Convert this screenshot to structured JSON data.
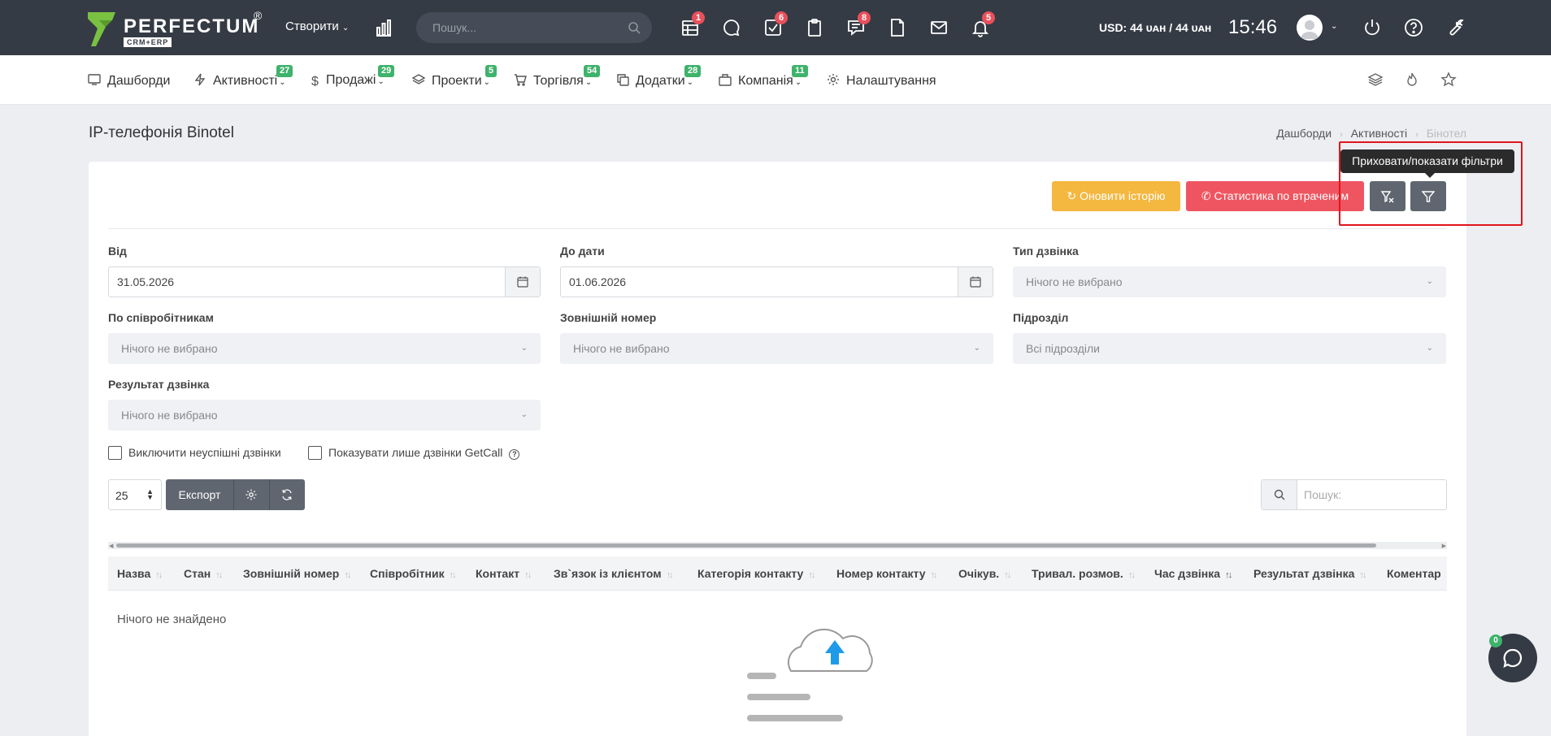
{
  "topbar": {
    "logo_text": "PERFECTUM",
    "logo_reg": "®",
    "logo_sub": "CRM+ERP",
    "create_label": "Створити",
    "search_placeholder": "Пошук...",
    "icons": [
      {
        "name": "calendar-grid-icon",
        "badge": "1"
      },
      {
        "name": "chat-bubble-icon",
        "badge": ""
      },
      {
        "name": "tasks-check-icon",
        "badge": "6"
      },
      {
        "name": "clipboard-icon",
        "badge": ""
      },
      {
        "name": "messages-icon",
        "badge": "8"
      },
      {
        "name": "document-icon",
        "badge": ""
      },
      {
        "name": "mail-icon",
        "badge": ""
      },
      {
        "name": "bell-icon",
        "badge": "5"
      }
    ],
    "currency": "USD: 44 ᴜᴀʜ / 44 ᴜᴀʜ",
    "clock": "15:46"
  },
  "menu": {
    "items": [
      {
        "label": "Дашборди",
        "badge": ""
      },
      {
        "label": "Активності",
        "badge": "27"
      },
      {
        "label": "Продажі",
        "badge": "29"
      },
      {
        "label": "Проекти",
        "badge": "5"
      },
      {
        "label": "Торгівля",
        "badge": "54"
      },
      {
        "label": "Додатки",
        "badge": "28"
      },
      {
        "label": "Компанія",
        "badge": "11"
      },
      {
        "label": "Налаштування",
        "badge": ""
      }
    ]
  },
  "page": {
    "title": "IP-телефонія Binotel",
    "breadcrumb": [
      "Дашборди",
      "Активності",
      "Бінотел"
    ]
  },
  "actions": {
    "refresh_label": "Оновити історію",
    "stats_label": "Статистика по втраченим",
    "tooltip": "Приховати/показати фільтри"
  },
  "filters": {
    "from_label": "Від",
    "from_value": "31.05.2026",
    "to_label": "До дати",
    "to_value": "01.06.2026",
    "call_type_label": "Тип дзвінка",
    "call_type_value": "Нічого не вибрано",
    "employees_label": "По співробітникам",
    "employees_value": "Нічого не вибрано",
    "external_label": "Зовнішній номер",
    "external_value": "Нічого не вибрано",
    "dept_label": "Підрозділ",
    "dept_value": "Всі підрозділи",
    "result_label": "Результат дзвінка",
    "result_value": "Нічого не вибрано",
    "exclude_failed": "Виключити неуспішні дзвінки",
    "only_getcall": "Показувати лише дзвінки GetCall"
  },
  "table": {
    "page_size": "25",
    "export_label": "Експорт",
    "search_placeholder": "Пошук:",
    "columns": [
      "Назва",
      "Стан",
      "Зовнішній номер",
      "Співробітник",
      "Контакт",
      "Зв`язок із клієнтом",
      "Категорія контакту",
      "Номер контакту",
      "Очікув.",
      "Тривал. розмов.",
      "Час дзвінка",
      "Результат дзвінка",
      "Коментар"
    ],
    "empty_text": "Нічого не знайдено"
  },
  "chat": {
    "badge": "0"
  },
  "colors": {
    "topbar": "#353b45",
    "refresh": "#f4b740",
    "stats": "#ef5560",
    "badge_green": "#3fb26b",
    "badge_red": "#e8505b",
    "highlight": "#e3141b"
  }
}
